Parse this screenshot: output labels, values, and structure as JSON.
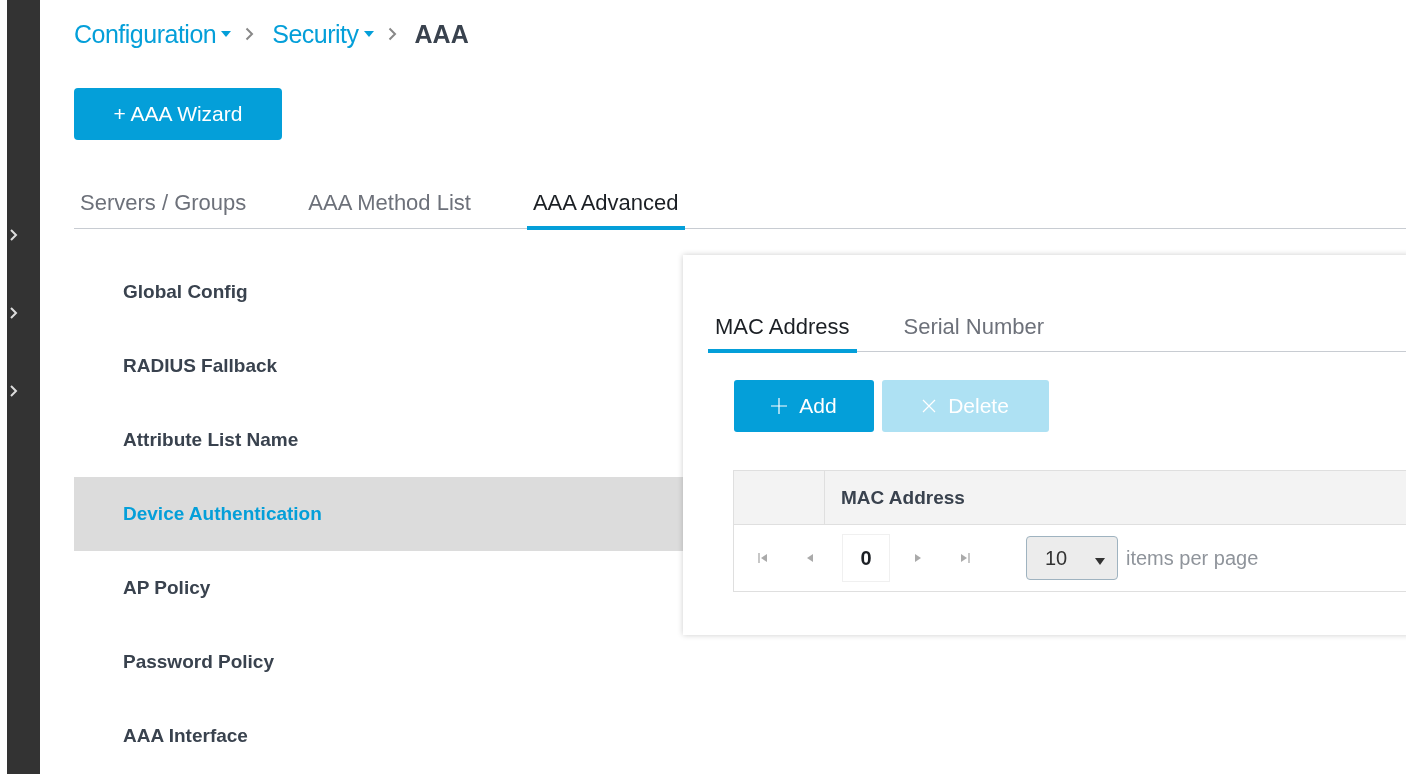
{
  "breadcrumb": [
    {
      "label": "Configuration",
      "kind": "menu"
    },
    {
      "label": "Security",
      "kind": "menu"
    },
    {
      "label": "AAA",
      "kind": "current"
    }
  ],
  "wizard_button": {
    "label": "AAA Wizard",
    "icon": "+"
  },
  "tabs": [
    {
      "label": "Servers / Groups",
      "selected": false
    },
    {
      "label": "AAA Method List",
      "selected": false
    },
    {
      "label": "AAA Advanced",
      "selected": true
    }
  ],
  "menu": [
    {
      "label": "Global Config",
      "selected": false
    },
    {
      "label": "RADIUS Fallback",
      "selected": false
    },
    {
      "label": "Attribute List Name",
      "selected": false
    },
    {
      "label": "Device Authentication",
      "selected": true
    },
    {
      "label": "AP Policy",
      "selected": false
    },
    {
      "label": "Password Policy",
      "selected": false
    },
    {
      "label": "AAA Interface",
      "selected": false
    }
  ],
  "panel": {
    "tabs": [
      {
        "label": "MAC Address",
        "selected": true
      },
      {
        "label": "Serial Number",
        "selected": false
      }
    ],
    "buttons": [
      {
        "label": "Add",
        "kind": "add",
        "disabled": false
      },
      {
        "label": "Delete",
        "kind": "delete",
        "disabled": true
      }
    ],
    "table": {
      "columns": [
        "MAC Address"
      ]
    },
    "pager": {
      "page": "0",
      "page_size": "10",
      "page_size_label": "items per page"
    }
  }
}
